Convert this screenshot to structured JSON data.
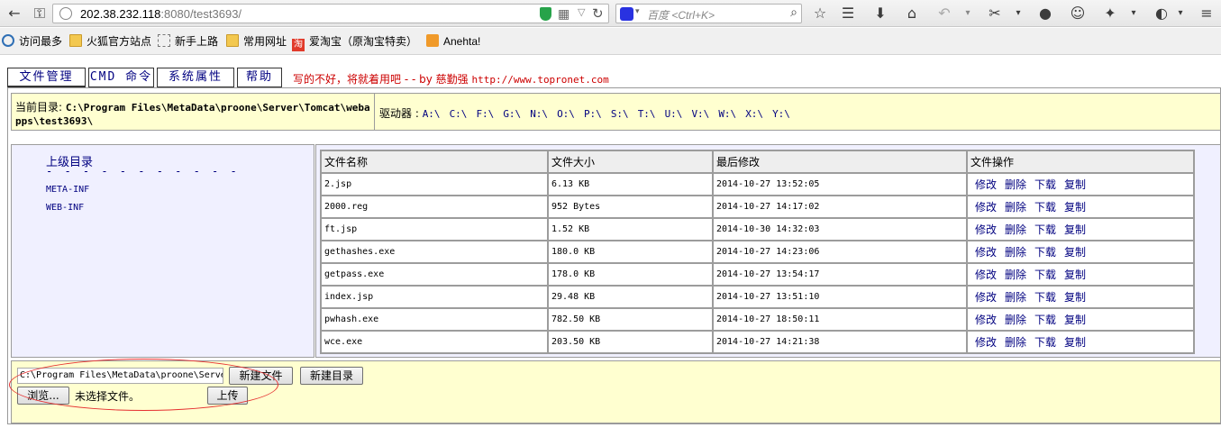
{
  "browser": {
    "url_host": "202.38.232.118",
    "url_rest": ":8080/test3693/",
    "search_placeholder": "百度 <Ctrl+K>"
  },
  "bookmarks": [
    {
      "label": "访问最多",
      "icon": "gear-icon"
    },
    {
      "label": "火狐官方站点",
      "icon": "folder-icon"
    },
    {
      "label": "新手上路",
      "icon": "page-icon"
    },
    {
      "label": "常用网址",
      "icon": "folder-icon"
    },
    {
      "label": "爱淘宝（原淘宝特卖）",
      "icon": "taobao-icon"
    },
    {
      "label": "Anehta!",
      "icon": "rss-icon"
    }
  ],
  "tabs": [
    "文件管理",
    "CMD 命令",
    "系统属性",
    "帮助"
  ],
  "note": {
    "text": "写的不好，将就着用吧 - - by 慈勤强",
    "link": "http://www.topronet.com"
  },
  "path": {
    "label": "当前目录:",
    "value": "C:\\Program Files\\MetaData\\proone\\Server\\Tomcat\\webapps\\test3693\\"
  },
  "drives": {
    "label": "驱动器 :",
    "items": [
      "A:\\",
      "C:\\",
      "F:\\",
      "G:\\",
      "N:\\",
      "O:\\",
      "P:\\",
      "S:\\",
      "T:\\",
      "U:\\",
      "V:\\",
      "W:\\",
      "X:\\",
      "Y:\\"
    ]
  },
  "sidebar": {
    "updir": "上级目录",
    "dashes": "- - - - - - - - - - -",
    "dirs": [
      "META-INF",
      "WEB-INF"
    ]
  },
  "table": {
    "headers": [
      "文件名称",
      "文件大小",
      "最后修改",
      "文件操作"
    ],
    "ops": [
      "修改",
      "删除",
      "下载",
      "复制"
    ],
    "rows": [
      {
        "name": "2.jsp",
        "size": "6.13 KB",
        "modified": "2014-10-27 13:52:05"
      },
      {
        "name": "2000.reg",
        "size": "952 Bytes",
        "modified": "2014-10-27 14:17:02"
      },
      {
        "name": "ft.jsp",
        "size": "1.52 KB",
        "modified": "2014-10-30 14:32:03"
      },
      {
        "name": "gethashes.exe",
        "size": "180.0 KB",
        "modified": "2014-10-27 14:23:06"
      },
      {
        "name": "getpass.exe",
        "size": "178.0 KB",
        "modified": "2014-10-27 13:54:17"
      },
      {
        "name": "index.jsp",
        "size": "29.48 KB",
        "modified": "2014-10-27 13:51:10"
      },
      {
        "name": "pwhash.exe",
        "size": "782.50 KB",
        "modified": "2014-10-27 18:50:11"
      },
      {
        "name": "wce.exe",
        "size": "203.50 KB",
        "modified": "2014-10-27 14:21:38"
      }
    ]
  },
  "bottom": {
    "path_value": "C:\\Program Files\\MetaData\\proone\\Server\\",
    "new_file": "新建文件",
    "new_dir": "新建目录",
    "browse": "浏览...",
    "no_file": "未选择文件。",
    "upload": "上传"
  }
}
